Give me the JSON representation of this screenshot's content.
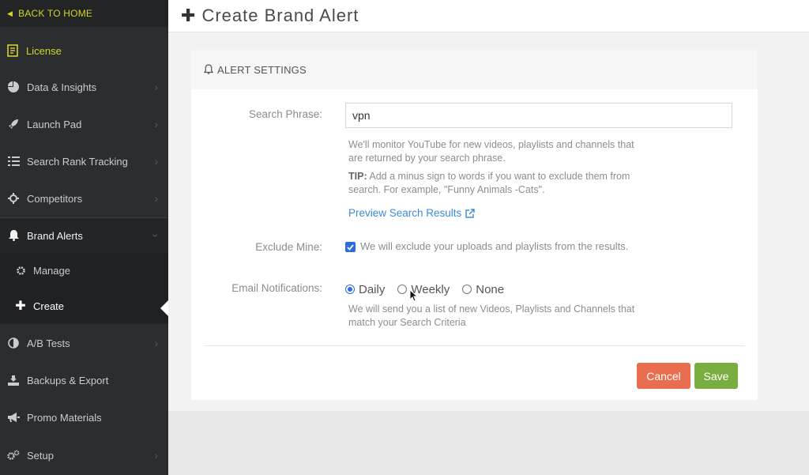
{
  "sidebar": {
    "back_label": "BACK TO HOME",
    "license_label": "License",
    "items": [
      {
        "label": "Data & Insights",
        "icon": "pie-chart-icon"
      },
      {
        "label": "Launch Pad",
        "icon": "rocket-icon"
      },
      {
        "label": "Search Rank Tracking",
        "icon": "list-icon"
      },
      {
        "label": "Competitors",
        "icon": "crosshair-icon"
      },
      {
        "label": "Brand Alerts",
        "icon": "bell-icon"
      },
      {
        "label": "A/B Tests",
        "icon": "contrast-icon"
      },
      {
        "label": "Backups & Export",
        "icon": "download-tray-icon"
      },
      {
        "label": "Promo Materials",
        "icon": "megaphone-icon"
      },
      {
        "label": "Setup",
        "icon": "gears-icon"
      }
    ],
    "sub_items": [
      {
        "label": "Manage",
        "icon": "gear-icon"
      },
      {
        "label": "Create",
        "icon": "plus-icon"
      }
    ]
  },
  "header": {
    "title": "Create Brand Alert"
  },
  "panel": {
    "heading": "ALERT SETTINGS",
    "search_phrase": {
      "label": "Search Phrase:",
      "value": "vpn",
      "help_line1": "We'll monitor YouTube for new videos, playlists and channels that",
      "help_line2": "are returned by your search phrase.",
      "tip_label": "TIP:",
      "tip_line1": " Add a minus sign to words if you want to exclude them from",
      "tip_line2": "search. For example, \"Funny Animals -Cats\".",
      "preview_link": "Preview Search Results"
    },
    "exclude_mine": {
      "label": "Exclude Mine:",
      "checked": true,
      "text": "We will exclude your uploads and playlists from the results."
    },
    "email_notifications": {
      "label": "Email Notifications:",
      "options": [
        "Daily",
        "Weekly",
        "None"
      ],
      "selected": "Daily",
      "help_line1": "We will send you a list of new Videos, Playlists and Channels that",
      "help_line2": "match your Search Criteria"
    },
    "buttons": {
      "cancel": "Cancel",
      "save": "Save"
    }
  },
  "colors": {
    "sidebar_bg": "#2b2d2f",
    "accent_yellow": "#d4d42a",
    "link_blue": "#3d8bd8",
    "cancel_orange": "#e96e50",
    "save_green": "#7aad3f",
    "radio_blue": "#2d6cdf"
  }
}
